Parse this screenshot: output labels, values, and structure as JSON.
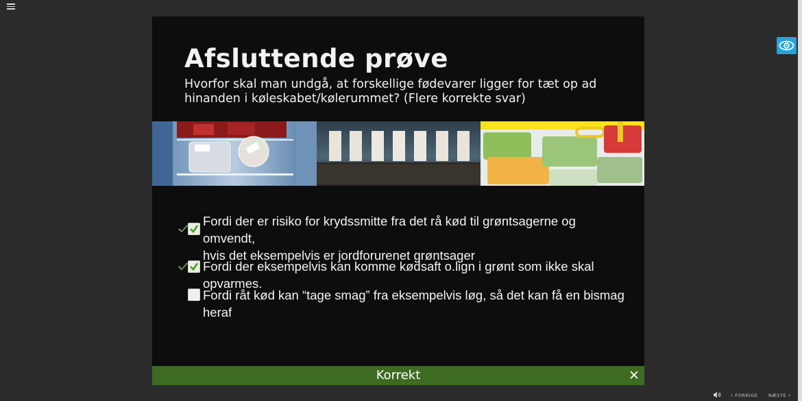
{
  "slide": {
    "title": "Afsluttende prøve",
    "question": "Hvorfor skal man undgå, at forskellige fødevarer ligger for tæt op ad hinanden i køleskabet/kølerummet? (Flere korrekte svar)"
  },
  "photos": [
    {
      "icon": "fridge-photo"
    },
    {
      "icon": "doors-photo"
    },
    {
      "icon": "food-containers-photo"
    }
  ],
  "options": [
    {
      "lines": [
        "Fordi der er risiko for krydssmitte fra det rå kød til grøntsagerne og omvendt,",
        "hvis det eksempelvis er jordforurenet grøntsager"
      ],
      "checked": true,
      "correct_mark": true
    },
    {
      "lines": [
        "Fordi der eksempelvis kan komme kødsaft o.lign i grønt som ikke skal opvarmes."
      ],
      "checked": true,
      "correct_mark": true
    },
    {
      "lines": [
        "Fordi råt kød kan “tage smag” fra eksempelvis løg, så det kan få en bismag heraf"
      ],
      "checked": false,
      "correct_mark": false
    }
  ],
  "feedback": {
    "text": "Korrekt",
    "color": "#3d6b21"
  },
  "nav": {
    "prev_label": "FORRIGE",
    "next_label": "NÆSTE"
  },
  "colors": {
    "background": "#2b2b2b",
    "slide": "#0d0d0d",
    "accent_eye": "#29a3d9",
    "check_green": "#4a9a2a"
  }
}
